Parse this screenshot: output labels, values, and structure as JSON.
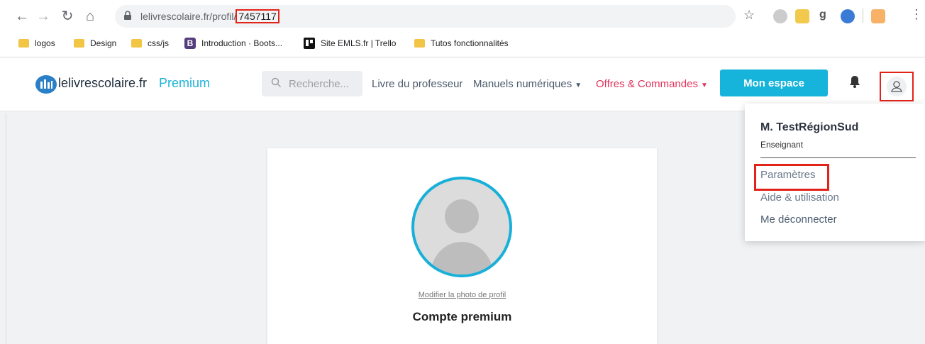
{
  "browser": {
    "url_domain": "lelivrescolaire.fr/profil/",
    "url_id": "7457117",
    "bookmarks": [
      {
        "label": "logos",
        "icon": "folder-icon"
      },
      {
        "label": "Design",
        "icon": "folder-icon"
      },
      {
        "label": "css/js",
        "icon": "folder-icon"
      },
      {
        "label": "Introduction · Boots...",
        "icon": "bootstrap-icon"
      },
      {
        "label": "Site EMLS.fr | Trello",
        "icon": "trello-icon"
      },
      {
        "label": "Tutos fonctionnalités",
        "icon": "folder-icon"
      }
    ]
  },
  "site": {
    "logo_text": "lelivrescolaire.fr",
    "logo_premium": "Premium",
    "search_placeholder": "Recherche...",
    "nav": {
      "livre": "Livre du professeur",
      "manuels": "Manuels numériques",
      "offres": "Offres & Commandes"
    },
    "mon_espace": "Mon espace"
  },
  "dropdown": {
    "name": "M. TestRégionSud",
    "role": "Enseignant",
    "items": [
      "Paramètres",
      "Aide & utilisation",
      "Me déconnecter"
    ]
  },
  "profile": {
    "change_photo": "Modifier la photo de profil",
    "account_type": "Compte premium"
  },
  "colors": {
    "accent": "#16b3da",
    "offres": "#e4315b",
    "highlight": "#e2231a"
  }
}
